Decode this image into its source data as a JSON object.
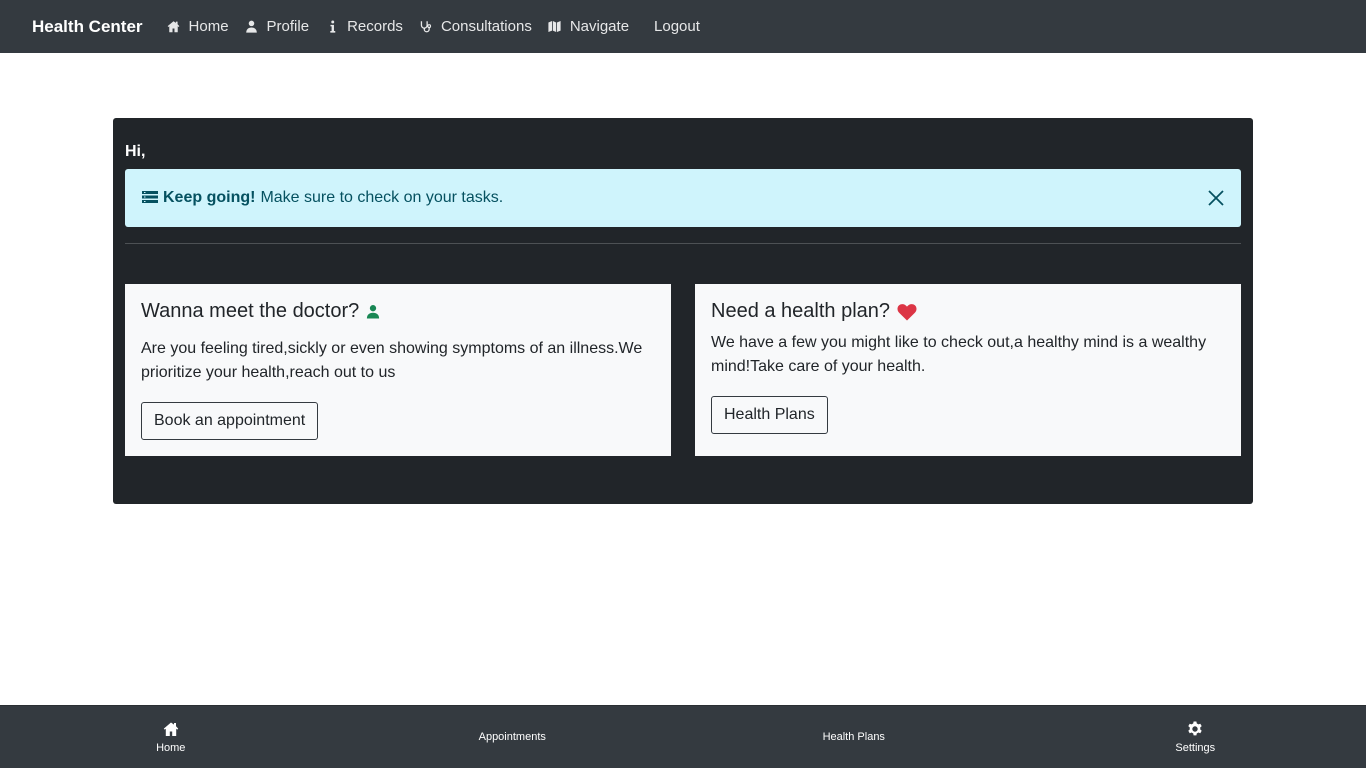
{
  "navbar": {
    "brand": "Health Center",
    "items": [
      {
        "label": "Home",
        "icon": "home-icon"
      },
      {
        "label": "Profile",
        "icon": "user-icon"
      },
      {
        "label": "Records",
        "icon": "info-icon"
      },
      {
        "label": "Consultations",
        "icon": "stethoscope-icon"
      },
      {
        "label": "Navigate",
        "icon": "map-icon"
      },
      {
        "label": "Logout"
      }
    ]
  },
  "main": {
    "greeting": "Hi,",
    "alert": {
      "icon": "list-icon",
      "strong": "Keep going!",
      "text": "Make sure to check on your tasks."
    },
    "cards": [
      {
        "title": "Wanna meet the doctor?",
        "icon": "user-icon",
        "icon_color": "#198754",
        "text": "Are you feeling tired,sickly or even showing symptoms of an illness.We prioritize your health,reach out to us",
        "button": "Book an appointment"
      },
      {
        "title": "Need a health plan?",
        "icon": "heart-icon",
        "icon_color": "#dc3545",
        "text": "We have a few you might like to check out,a healthy mind is a wealthy mind!Take care of your health.",
        "button": "Health Plans"
      }
    ]
  },
  "bottom_nav": {
    "items": [
      {
        "label": "Home",
        "icon": "home-icon"
      },
      {
        "label": "Appointments"
      },
      {
        "label": "Health Plans"
      },
      {
        "label": "Settings",
        "icon": "gear-icon"
      }
    ]
  },
  "colors": {
    "navbar_bg": "#343a40",
    "panel_bg": "#212529",
    "alert_bg": "#cff4fc",
    "alert_text": "#055160",
    "card_bg": "#f8f9fa"
  }
}
